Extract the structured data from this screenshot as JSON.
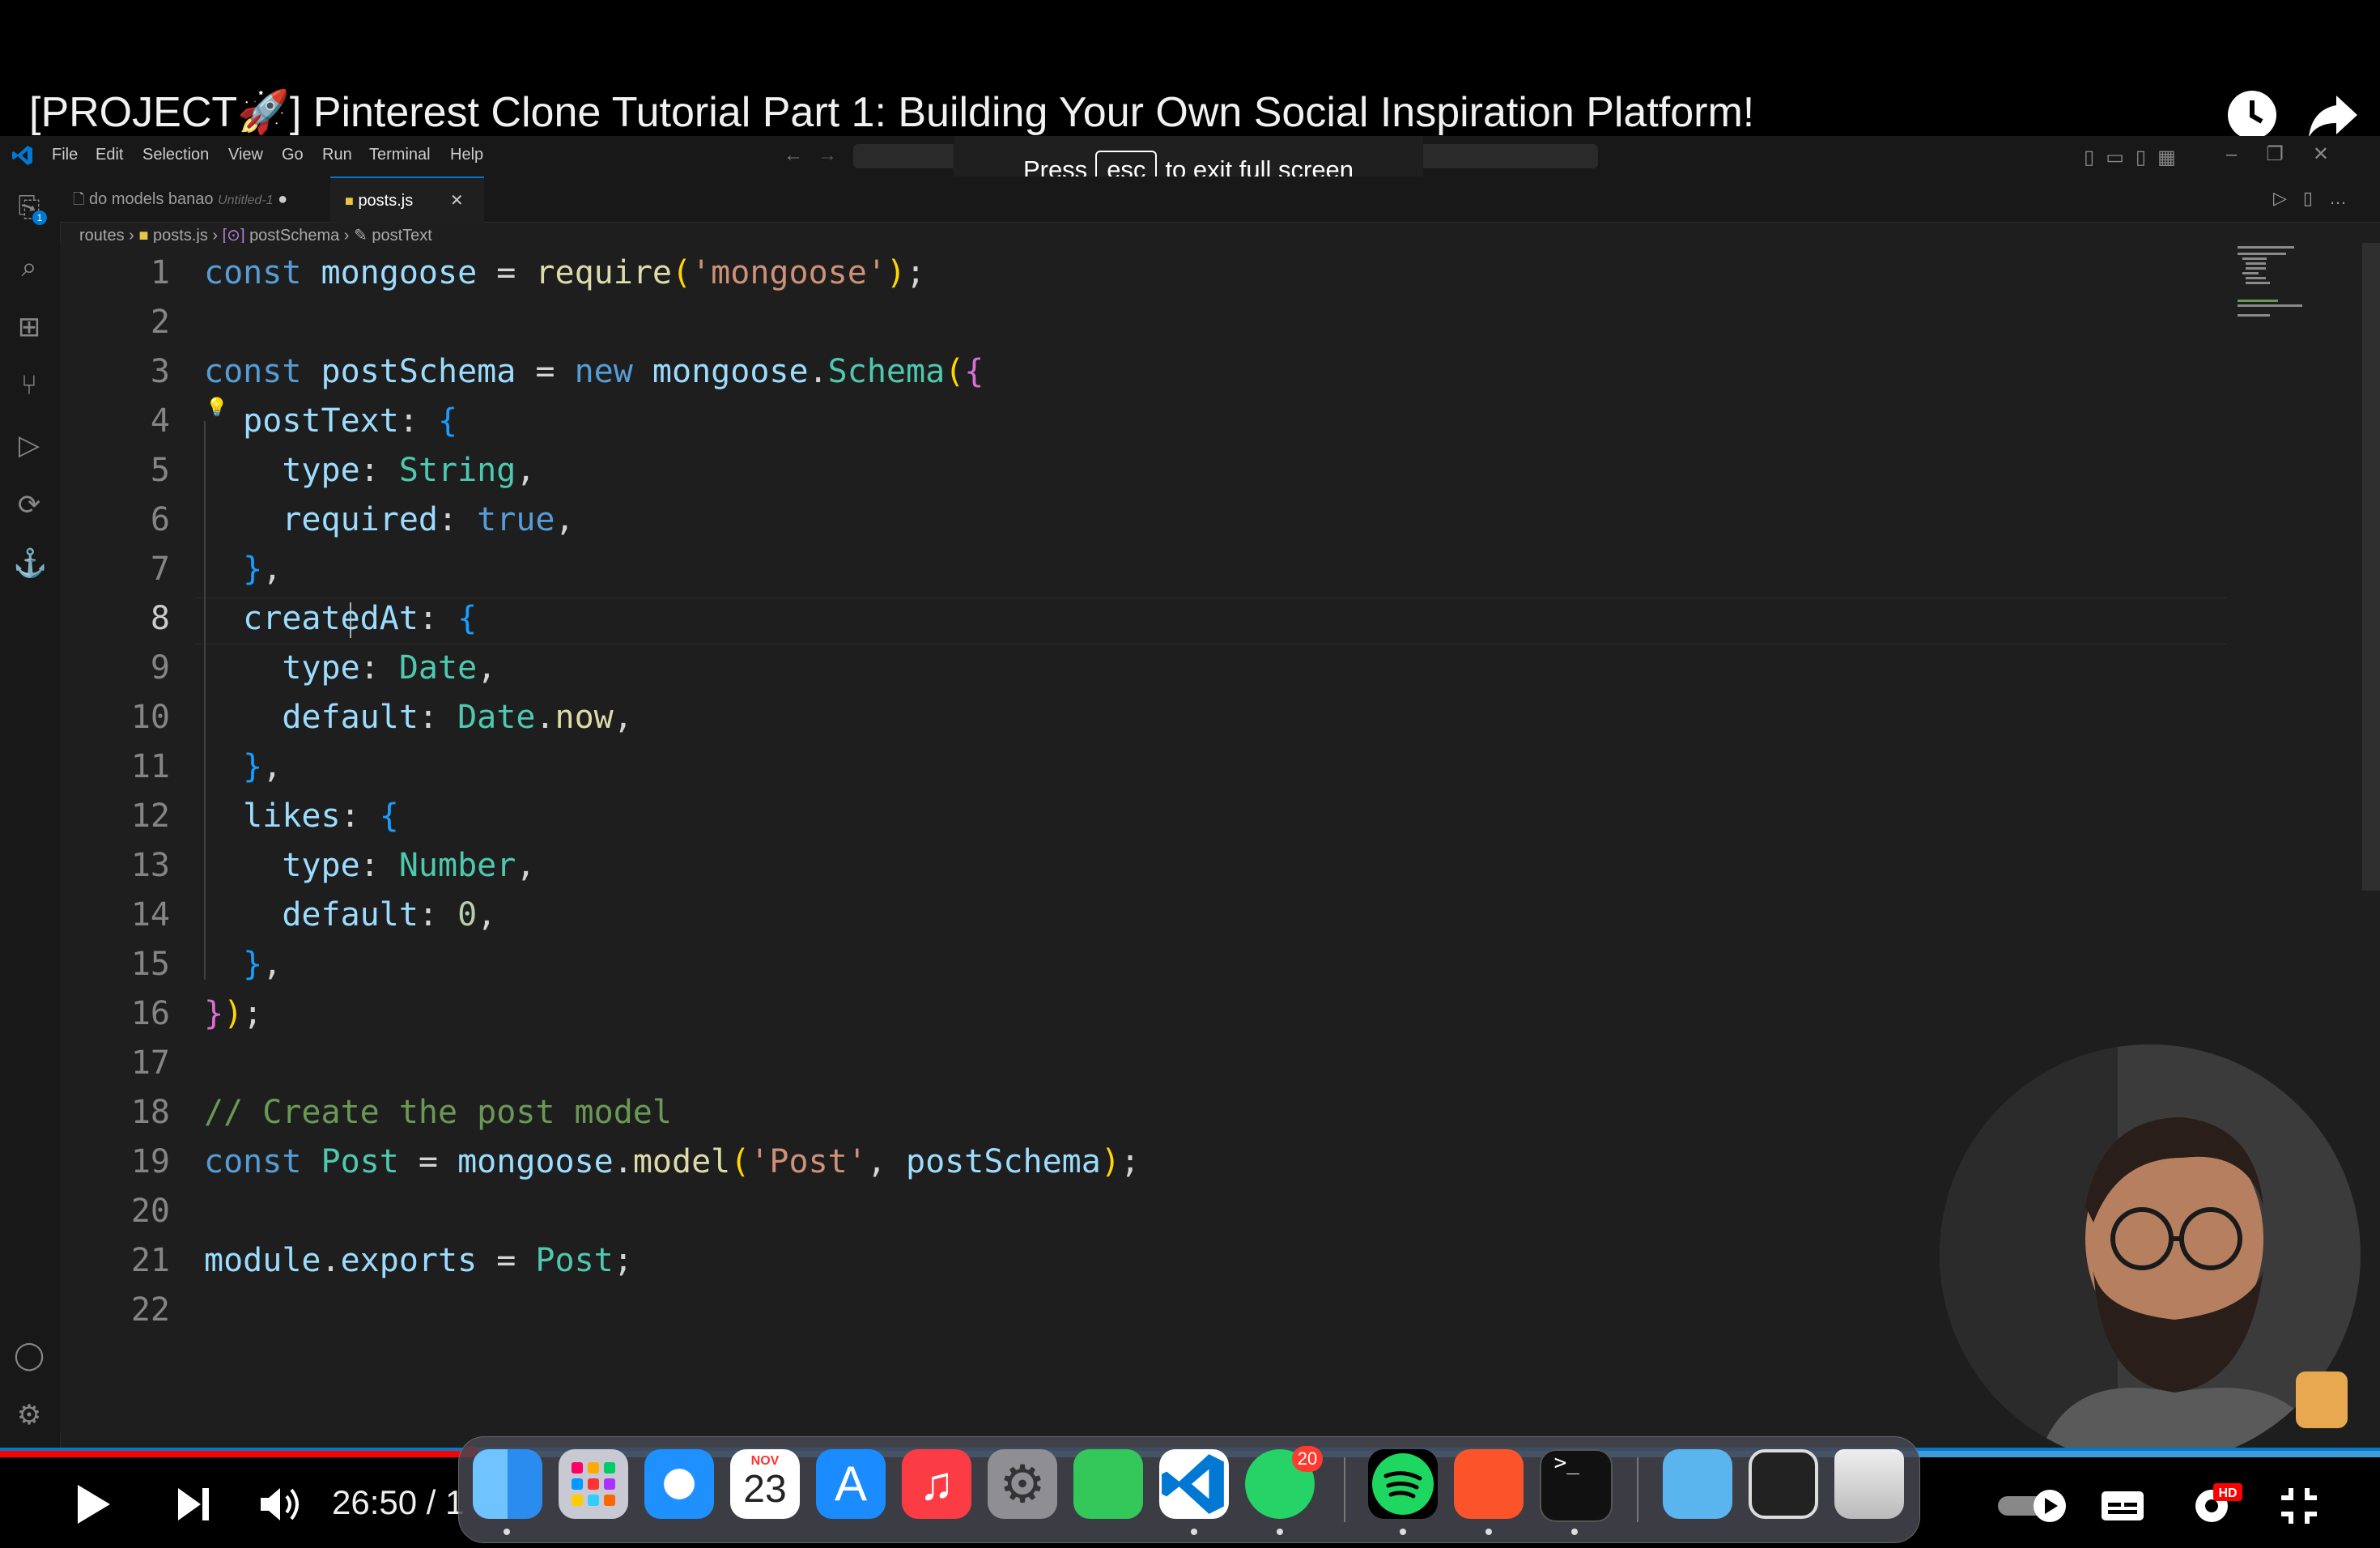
{
  "video": {
    "title": "[PROJECT🚀] Pinterest Clone Tutorial Part 1: Building Your Own Social Inspiration Platform!",
    "timecode": "26:50 / 1"
  },
  "fullscreen_toast": {
    "press": "Press",
    "key": "esc",
    "rest": "to exit full screen"
  },
  "menu": [
    "File",
    "Edit",
    "Selection",
    "View",
    "Go",
    "Run",
    "Terminal",
    "Help"
  ],
  "tabs": [
    {
      "label": "do models banao",
      "hint": "Untitled-1",
      "dirty": "●"
    },
    {
      "label": "posts.js",
      "close": "✕"
    }
  ],
  "breadcrumb": [
    "routes",
    "posts.js",
    "postSchema",
    "postText"
  ],
  "line_numbers": [
    "1",
    "2",
    "3",
    "4",
    "5",
    "6",
    "7",
    "8",
    "9",
    "10",
    "11",
    "12",
    "13",
    "14",
    "15",
    "16",
    "17",
    "18",
    "19",
    "20",
    "21",
    "22"
  ],
  "dock": {
    "calendar_month": "NOV",
    "calendar_day": "23",
    "whatsapp_badge": "20"
  },
  "colors": {
    "accent": "#007acc",
    "progress": "#ff0000"
  }
}
